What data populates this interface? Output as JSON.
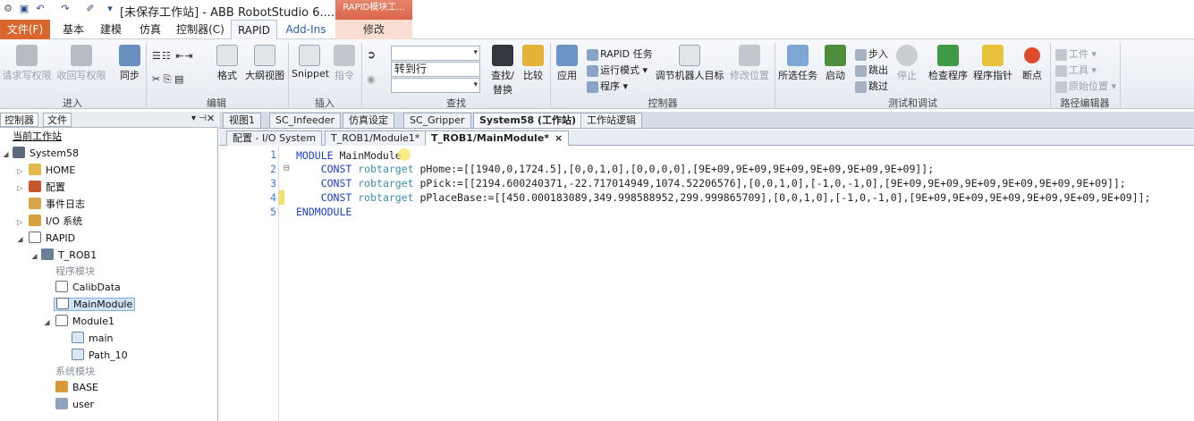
{
  "titlebar": {
    "title": "[未保存工作站] - ABB RobotStudio 6....",
    "context_tab_header": "RAPID模块工..."
  },
  "menu": {
    "file": "文件(F)",
    "tabs": [
      "基本",
      "建模",
      "仿真",
      "控制器(C)",
      "RAPID",
      "Add-Ins",
      "修改"
    ]
  },
  "ribbon": {
    "groups": {
      "access": "进入",
      "edit": "编辑",
      "insert": "插入",
      "find": "查找",
      "controller": "控制器",
      "test": "测试和调试",
      "path_editor": "路径编辑器"
    },
    "buttons": {
      "request_write": "请求写权限",
      "revoke_write": "收回写权限",
      "sync": "同步",
      "format": "格式",
      "outline": "大纲视图",
      "snippet": "Snippet",
      "instruction": "指令",
      "goto_line": "转到行",
      "find_replace_1": "查找/",
      "find_replace_2": "替换",
      "compare": "比较",
      "apply": "应用",
      "rapid_tasks": "RAPID 任务",
      "run_mode": "运行模式",
      "program": "程序",
      "adjust_targets": "调节机器人目标",
      "modify_position": "修改位置",
      "selected_tasks": "所选任务",
      "start": "启动",
      "step_in": "步入",
      "step_out": "跳出",
      "step_over": "跳过",
      "stop": "停止",
      "check_program": "检查程序",
      "program_pointer": "程序指针",
      "breakpoint": "断点",
      "tool": "工件",
      "tool2": "工具",
      "origin": "原始位置"
    }
  },
  "left_panel": {
    "tabs": [
      "控制器",
      "文件"
    ],
    "pin": "▾ 📌",
    "close": "✕",
    "tree": {
      "current_station": "当前工作站",
      "system": "System58",
      "home": "HOME",
      "config": "配置",
      "event_log": "事件日志",
      "io": "I/O 系统",
      "rapid": "RAPID",
      "task": "T_ROB1",
      "program_modules": "程序模块",
      "calibdata": "CalibData",
      "mainmodule": "MainModule",
      "module1": "Module1",
      "main": "main",
      "path10": "Path_10",
      "system_modules": "系统模块",
      "base": "BASE",
      "user": "user"
    }
  },
  "doc_tabs_top": [
    "视图1",
    "SC_Infeeder",
    "仿真设定",
    "SC_Gripper",
    "System58 (工作站)",
    "工作站逻辑"
  ],
  "doc_tabs_sub": [
    "配置 - I/O System",
    "T_ROB1/Module1*",
    "T_ROB1/MainModule*"
  ],
  "close_glyph": "×",
  "editor": {
    "line_numbers": [
      "1",
      "2",
      "3",
      "4",
      "5"
    ],
    "fold_glyph": "⊟",
    "lines": [
      {
        "kw": "MODULE",
        "rest": " MainModule"
      },
      {
        "indent": "    ",
        "kw": "CONST",
        "ty": " robtarget",
        "rest": " pHome:=[[1940,0,1724.5],[0,0,1,0],[0,0,0,0],[9E+09,9E+09,9E+09,9E+09,9E+09,9E+09]];"
      },
      {
        "indent": "    ",
        "kw": "CONST",
        "ty": " robtarget",
        "rest": " pPick:=[[2194.600240371,-22.717014949,1074.52206576],[0,0,1,0],[-1,0,-1,0],[9E+09,9E+09,9E+09,9E+09,9E+09,9E+09]];"
      },
      {
        "indent": "    ",
        "kw": "CONST",
        "ty": " robtarget",
        "rest": " pPlaceBase:=[[450.000183089,349.998588952,299.999865709],[0,0,1,0],[-1,0,-1,0],[9E+09,9E+09,9E+09,9E+09,9E+09,9E+09]];"
      },
      {
        "kw": "ENDMODULE",
        "rest": ""
      }
    ]
  }
}
